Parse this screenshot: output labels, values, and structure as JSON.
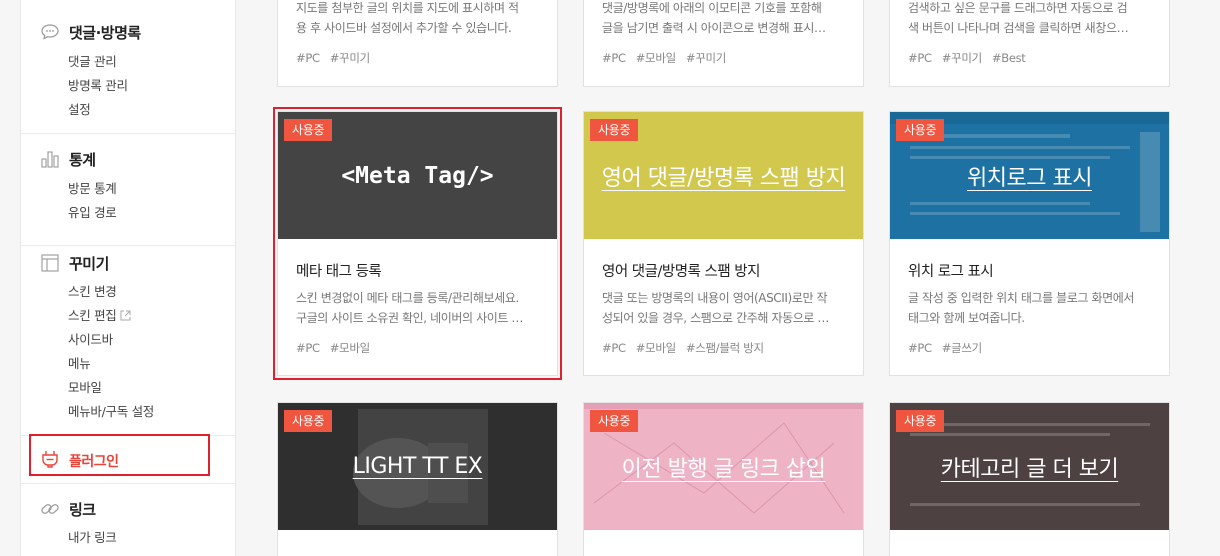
{
  "sidebar": {
    "comments": {
      "title": "댓글·방명록",
      "items": [
        "댓글 관리",
        "방명록 관리",
        "설정"
      ]
    },
    "stats": {
      "title": "통계",
      "items": [
        "방문 통계",
        "유입 경로"
      ]
    },
    "decor": {
      "title": "꾸미기",
      "items": [
        "스킨 변경",
        "스킨 편집",
        "사이드바",
        "메뉴",
        "모바일",
        "메뉴바/구독 설정"
      ]
    },
    "plugin": {
      "title": "플러그인"
    },
    "link": {
      "title": "링크",
      "items": [
        "내가 링크"
      ]
    }
  },
  "top_cards": [
    {
      "desc": [
        "지도를 첨부한 글의 위치를 지도에 표시하며 적",
        "용 후 사이드바 설정에서 추가할 수 있습니다."
      ],
      "tags": [
        "#PC",
        "#꾸미기"
      ]
    },
    {
      "desc": [
        "댓글/방명록에 아래의 이모티콘 기호를 포함해",
        "글을 남기면 출력 시 아이콘으로 변경해 표시…"
      ],
      "tags": [
        "#PC",
        "#모바일",
        "#꾸미기"
      ]
    },
    {
      "desc": [
        "검색하고 싶은 문구를 드래그하면 자동으로 검",
        "색 버튼이 나타나며 검색을 클릭하면 새창으…"
      ],
      "tags": [
        "#PC",
        "#꾸미기",
        "#Best"
      ]
    }
  ],
  "cards": [
    {
      "badge": "사용중",
      "thumb": "<Meta Tag/>",
      "title": "메타 태그 등록",
      "desc": [
        "스킨 변경없이 메타 태그를 등록/관리해보세요.",
        "구글의 사이트 소유권 확인, 네이버의 사이트 …"
      ],
      "tags": [
        "#PC",
        "#모바일"
      ]
    },
    {
      "badge": "사용중",
      "thumb": "영어 댓글/방명록 스팸 방지",
      "title": "영어 댓글/방명록 스팸 방지",
      "desc": [
        "댓글 또는 방명록의 내용이 영어(ASCII)로만 작",
        "성되어 있을 경우, 스팸으로 간주해 자동으로 …"
      ],
      "tags": [
        "#PC",
        "#모바일",
        "#스팸/블럭 방지"
      ]
    },
    {
      "badge": "사용중",
      "thumb": "위치로그 표시",
      "title": "위치 로그 표시",
      "desc": [
        "글 작성 중 입력한 위치 태그를 블로그 화면에서",
        "태그와 함께 보여줍니다."
      ],
      "tags": [
        "#PC",
        "#글쓰기"
      ]
    },
    {
      "badge": "사용중",
      "thumb": "LIGHT TT EX"
    },
    {
      "badge": "사용중",
      "thumb": "이전 발행 글 링크 삽입"
    },
    {
      "badge": "사용중",
      "thumb": "카테고리 글 더 보기"
    }
  ],
  "colors": {
    "accent": "#f0563f",
    "selection": "#e0202a",
    "meta_thumb": "#444444",
    "spam_thumb": "#d2c84e",
    "location_thumb": "#1e72a3",
    "light_thumb": "#2f2f2f",
    "prev_thumb": "#efb3c6",
    "category_thumb": "#4d4141"
  }
}
